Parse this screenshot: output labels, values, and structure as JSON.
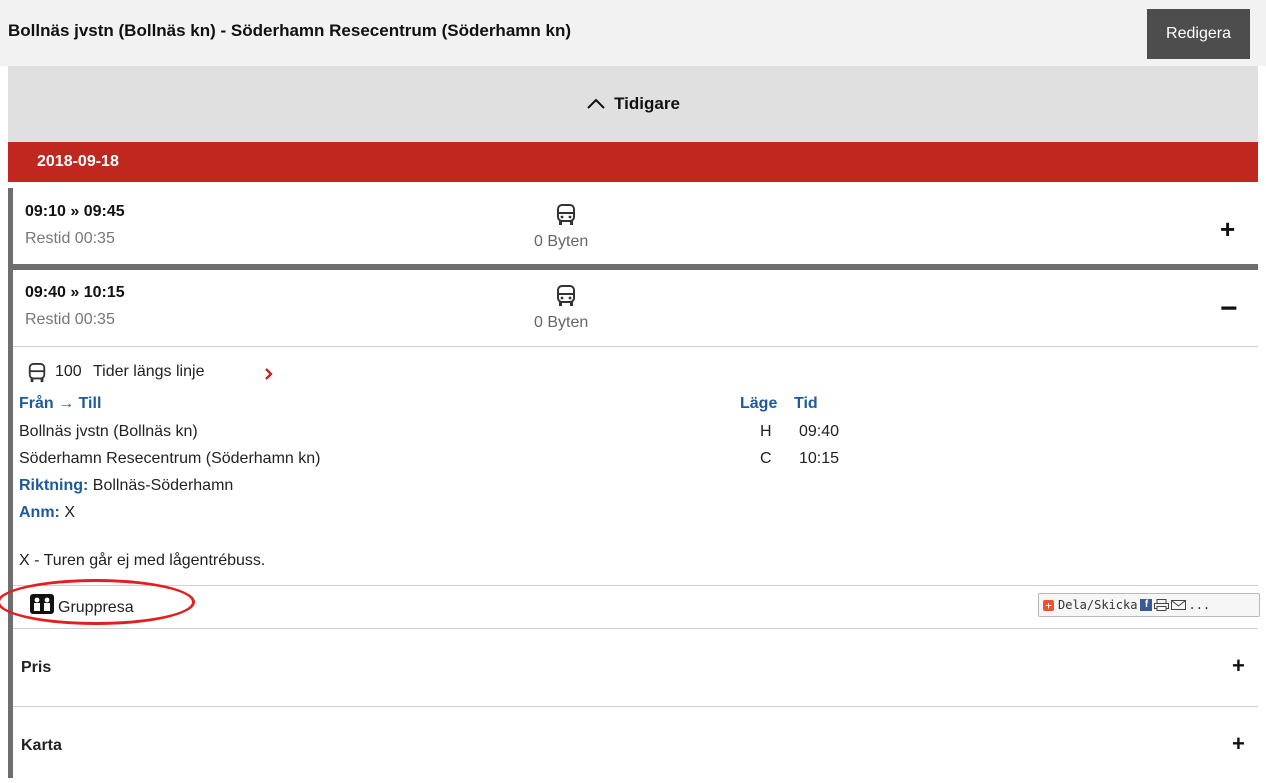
{
  "header": {
    "title": "Bollnäs jvstn (Bollnäs kn) - Söderhamn Resecentrum (Söderhamn kn)",
    "edit_label": "Redigera"
  },
  "earlier": {
    "label": "Tidigare",
    "icon": "chevron-up-icon"
  },
  "date": "2018-09-18",
  "trips": [
    {
      "times": "09:10 » 09:45",
      "duration": "Restid 00:35",
      "changes": "0 Byten",
      "toggle": "+",
      "expanded": false
    },
    {
      "times": "09:40 » 10:15",
      "duration": "Restid 00:35",
      "changes": "0 Byten",
      "toggle": "−",
      "expanded": true
    }
  ],
  "details": {
    "line_number": "100",
    "line_link": "Tider längs linje",
    "from_to_header": "Från → Till",
    "stop_header": "Läge",
    "time_header": "Tid",
    "stops": [
      {
        "name": "Bollnäs jvstn (Bollnäs kn)",
        "stop": "H",
        "time": "09:40"
      },
      {
        "name": "Söderhamn Resecentrum (Söderhamn kn)",
        "stop": "C",
        "time": "10:15"
      }
    ],
    "direction_label": "Riktning:",
    "direction_value": "Bollnäs-Söderhamn",
    "note_label": "Anm:",
    "note_value": "X",
    "footnote": "X - Turen går ej med lågentrébuss.",
    "group_travel": "Gruppresa",
    "share_label": "Dela/Skicka"
  },
  "sections": [
    {
      "label": "Pris",
      "toggle": "+"
    },
    {
      "label": "Karta",
      "toggle": "+"
    }
  ],
  "colors": {
    "date_bar": "#c0271f",
    "link_blue": "#1e5a9b",
    "annotation_circle": "#e41e1e"
  }
}
